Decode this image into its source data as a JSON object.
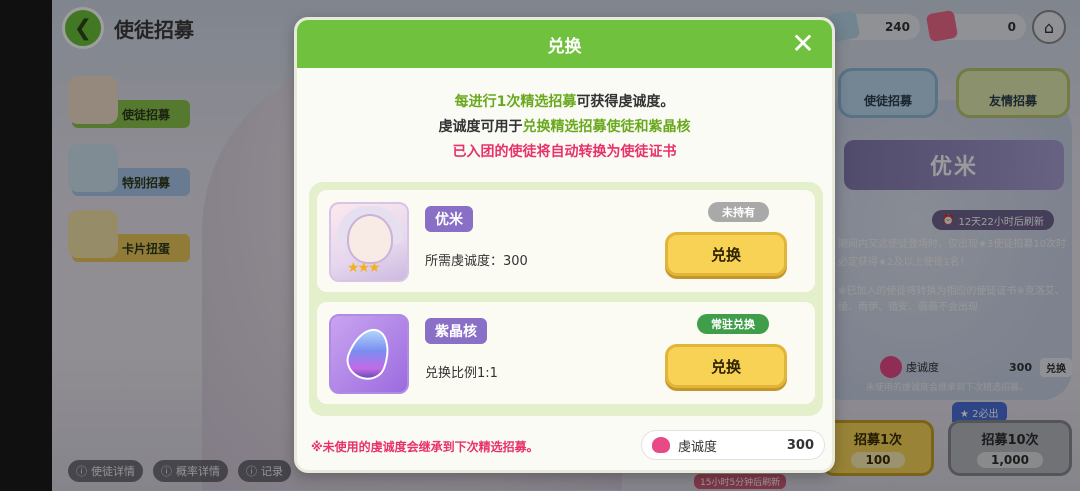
{
  "header": {
    "title": "使徒招募",
    "currency_1": "240",
    "currency_2": "0"
  },
  "sidebar": {
    "items": [
      {
        "label": "使徒招募"
      },
      {
        "label": "特别招募"
      },
      {
        "label": "卡片扭蛋"
      }
    ]
  },
  "right_tabs": [
    {
      "label": "使徒招募"
    },
    {
      "label": "友情招募"
    }
  ],
  "banner": {
    "title": "优米",
    "timer": "12天22小时后刷新",
    "desc": "期间内又这使徒登场时，仅出现★3使徒招募10次时必定获得★2及以上使徒1名！",
    "desc2": "※已加入的使徒将转换为相应的使徒证书※克洛艾、绫、雨伊、错安、薇薇不会出现",
    "devotion_label": "虔诚度",
    "devotion_value": "300",
    "exchange_label": "兑换",
    "carry_note": "未使用的虔诚度会继承到下次精选招募。",
    "guarantee_badge": "★ 2必出"
  },
  "pull_buttons": [
    {
      "label": "招募1次",
      "cost": "100"
    },
    {
      "label": "招募10次",
      "cost": "1,000"
    }
  ],
  "bottom_links": [
    {
      "label": "使徒详情"
    },
    {
      "label": "概率详情"
    },
    {
      "label": "记录"
    }
  ],
  "bottom_timer": "15小时5分钟后刷新",
  "modal": {
    "title": "兑换",
    "info_line1_a": "每进行1次",
    "info_line1_b": "精选招募",
    "info_line1_c": "可获得虔诚度。",
    "info_line2_a": "虔诚度可用于",
    "info_line2_b": "兑换精选招募使徒和紫晶核",
    "info_line3": "已入团的使徒将自动转换为使徒证书",
    "items": [
      {
        "name": "优米",
        "status": "未持有",
        "subtext": "所需虔诚度：300",
        "button": "兑换"
      },
      {
        "name": "紫晶核",
        "status": "常驻兑换",
        "subtext": "兑换比例1:1",
        "button": "兑换"
      }
    ],
    "footer_note": "※未使用的虔诚度会继承到下次精选招募。",
    "balance_label": "虔诚度",
    "balance_value": "300",
    "colors": {
      "header_green": "#70c23e",
      "accent_pink": "#e8326a",
      "accent_green": "#6aa81e"
    }
  }
}
